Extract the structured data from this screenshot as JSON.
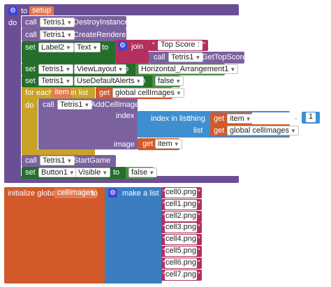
{
  "procedure": {
    "to": "to",
    "name": "setup",
    "do": "do",
    "call1": {
      "kw": "call",
      "component": "Tetris1",
      "method": ".DestroyInstance"
    },
    "call2": {
      "kw": "call",
      "component": "Tetris1",
      "method": ".CreateRenderer"
    },
    "set1": {
      "kw": "set",
      "component": "Label2",
      "prop": "Text",
      "to": "to",
      "join": "join",
      "str": "Top Score : ",
      "call": "call",
      "comp2": "Tetris1",
      "method2": ".GetTopScore"
    },
    "set2": {
      "kw": "set",
      "component": "Tetris1",
      "prop": "ViewLayout",
      "to": "to",
      "value": "Horizontal_Arrangement1"
    },
    "set3": {
      "kw": "set",
      "component": "Tetris1",
      "prop": "UseDefaultAlerts",
      "to": "to",
      "value": "false"
    },
    "foreach": {
      "label": "for each",
      "var": "item",
      "inlist": "in list",
      "get": "get",
      "listname": "global cellImages",
      "do": "do"
    },
    "addcell": {
      "kw": "call",
      "component": "Tetris1",
      "method": ".AddCellImage",
      "index_label": "index",
      "image_label": "image",
      "get": "get",
      "item": "item"
    },
    "indexinlist": {
      "label": "index in list",
      "thing": "thing",
      "get": "get",
      "thingvar": "item",
      "list": "list",
      "listvar": "global cellImages",
      "number": "1"
    },
    "call3": {
      "kw": "call",
      "component": "Tetris1",
      "method": ".StartGame"
    },
    "set4": {
      "kw": "set",
      "component": "Button1",
      "prop": "Visible",
      "to": "to",
      "value": "false"
    }
  },
  "global": {
    "label": "initialize global",
    "name": "cellImages",
    "to": "to",
    "makelist": "make a list",
    "items": [
      "cell0.png",
      "cell1.png",
      "cell2.png",
      "cell3.png",
      "cell4.png",
      "cell5.png",
      "cell6.png",
      "cell7.png"
    ]
  },
  "icons": {
    "gear": "gear-icon",
    "dropdown": "chevron-down-icon"
  }
}
